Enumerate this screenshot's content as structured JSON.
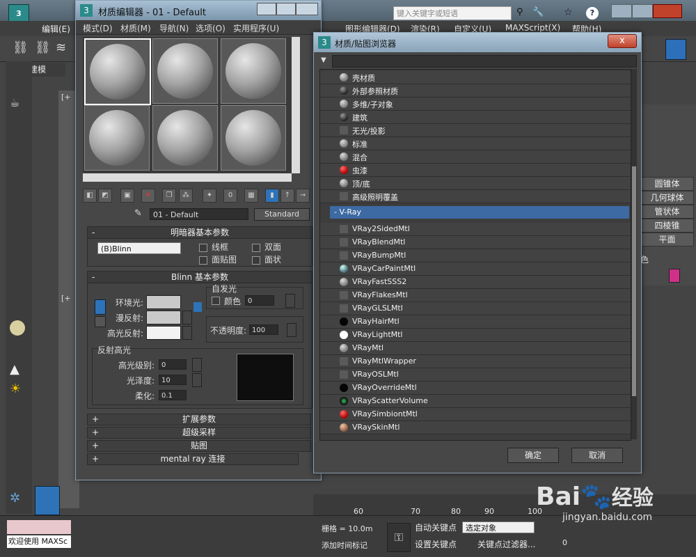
{
  "main": {
    "search_placeholder": "键入关键字或短语",
    "menu_left": "编辑(E)",
    "menu_items": [
      "图形编辑器(D)",
      "渲染(R)",
      "自定义(U)",
      "MAXScript(X)",
      "帮助(H)"
    ],
    "ribbon_tab": "建模",
    "viewport_label": "[+",
    "right_panel_items": [
      "圆锥体",
      "几何球体",
      "管状体",
      "四棱锥",
      "平面"
    ],
    "right_panel_color_label": "色",
    "timeline_ticks": [
      "60",
      "70",
      "80",
      "90",
      "100"
    ],
    "status_welcome": "欢迎使用 MAXSc",
    "status_grid": "栅格 = 10.0m",
    "status_addtime": "添加时间标记",
    "auto_key": "自动关键点",
    "set_key": "设置关键点",
    "selected_object": "选定对象",
    "key_filter": "关键点过滤器...",
    "frame_value": "0"
  },
  "material_editor": {
    "title": "材质编辑器 - 01 - Default",
    "menus": [
      "模式(D)",
      "材质(M)",
      "导航(N)",
      "选项(O)",
      "实用程序(U)"
    ],
    "material_name": "01 - Default",
    "material_type": "Standard",
    "shader_rollout": {
      "title": "明暗器基本参数",
      "shader": "(B)Blinn",
      "wire": "线框",
      "two_sided": "双面",
      "face_map": "面贴图",
      "faceted": "面状"
    },
    "blinn_rollout": {
      "title": "Blinn 基本参数",
      "ambient": "环境光:",
      "diffuse": "漫反射:",
      "specular": "高光反射:",
      "self_illum": "自发光",
      "color": "颜色",
      "color_value": "0",
      "opacity": "不透明度:",
      "opacity_value": "100",
      "spec_highlights": "反射高光",
      "spec_level": "高光级别:",
      "spec_level_value": "0",
      "glossiness": "光泽度:",
      "glossiness_value": "10",
      "soften": "柔化:",
      "soften_value": "0.1"
    },
    "collapsed_rollouts": [
      "扩展参数",
      "超级采样",
      "贴图",
      "mental ray 连接"
    ]
  },
  "browser": {
    "title": "材质/贴图浏览器",
    "close": "x",
    "standard_items": [
      {
        "label": "壳材质",
        "icon": "gray-sphere"
      },
      {
        "label": "外部参照材质",
        "icon": "dark-sphere"
      },
      {
        "label": "多维/子对象",
        "icon": "gray-sphere"
      },
      {
        "label": "建筑",
        "icon": "dark-sphere"
      },
      {
        "label": "无光/投影",
        "icon": "square"
      },
      {
        "label": "标准",
        "icon": "gray-sphere"
      },
      {
        "label": "混合",
        "icon": "gray-sphere"
      },
      {
        "label": "虫漆",
        "icon": "red-sphere"
      },
      {
        "label": "顶/底",
        "icon": "gray-sphere"
      },
      {
        "label": "高级照明覆盖",
        "icon": "square"
      }
    ],
    "group_label": "- V-Ray",
    "vray_items": [
      {
        "label": "VRay2SidedMtl",
        "icon": "square"
      },
      {
        "label": "VRayBlendMtl",
        "icon": "square"
      },
      {
        "label": "VRayBumpMtl",
        "icon": "square"
      },
      {
        "label": "VRayCarPaintMtl",
        "icon": "blue-sphere"
      },
      {
        "label": "VRayFastSSS2",
        "icon": "gray-sphere"
      },
      {
        "label": "VRayFlakesMtl",
        "icon": "square"
      },
      {
        "label": "VRayGLSLMtl",
        "icon": "square"
      },
      {
        "label": "VRayHairMtl",
        "icon": "black-sphere"
      },
      {
        "label": "VRayLightMtl",
        "icon": "white-sphere"
      },
      {
        "label": "VRayMtl",
        "icon": "gray-sphere"
      },
      {
        "label": "VRayMtlWrapper",
        "icon": "square"
      },
      {
        "label": "VRayOSLMtl",
        "icon": "square"
      },
      {
        "label": "VRayOverrideMtl",
        "icon": "black-sphere"
      },
      {
        "label": "VRayScatterVolume",
        "icon": "speckle-sphere"
      },
      {
        "label": "VRaySimbiontMtl",
        "icon": "red-sphere"
      },
      {
        "label": "VRaySkinMtl",
        "icon": "skin-sphere"
      }
    ],
    "ok": "确定",
    "cancel": "取消"
  },
  "watermark": {
    "brand": "Bai",
    "brand2": "经验",
    "url": "jingyan.baidu.com"
  }
}
